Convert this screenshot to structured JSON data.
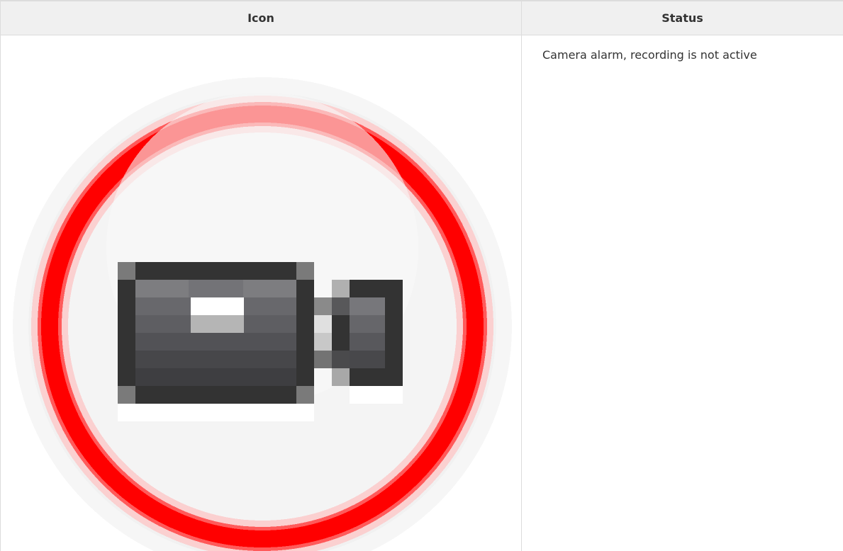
{
  "table": {
    "headers": {
      "icon": "Icon",
      "status": "Status"
    },
    "rows": [
      {
        "icon_name": "camera-alarm-not-recording-icon",
        "status": "Camera alarm, recording is not active"
      }
    ]
  },
  "colors": {
    "alarm_red": "#ff0000",
    "camera_dark": "#333333",
    "header_bg": "#f0f0f0",
    "border": "#dcdcdc"
  }
}
